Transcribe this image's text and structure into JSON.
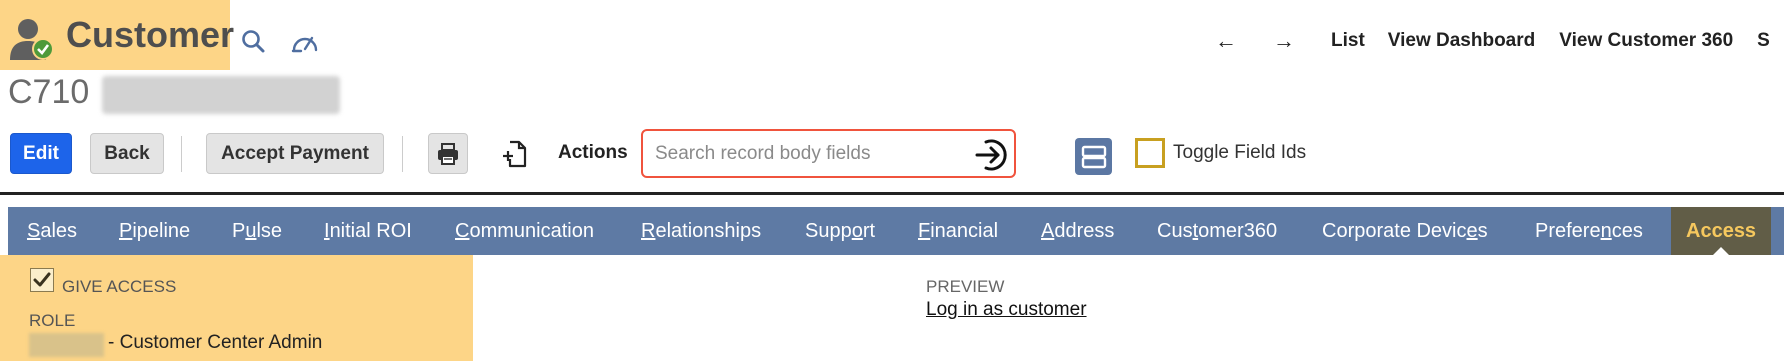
{
  "header": {
    "title": "Customer",
    "record_id": "C710",
    "record_icon": "customer-approved-icon",
    "search_icon": "search-icon",
    "dashboard_icon": "speedometer-icon"
  },
  "topnav": {
    "back_arrow": "←",
    "forward_arrow": "→",
    "list": "List",
    "view_dashboard": "View Dashboard",
    "view_customer_360": "View Customer 360",
    "overflow": "S"
  },
  "toolbar": {
    "edit": "Edit",
    "back": "Back",
    "accept_payment": "Accept Payment",
    "actions": "Actions",
    "search_placeholder": "Search record body fields",
    "toggle_field_ids": "Toggle Field Ids"
  },
  "tabs": [
    {
      "label": "Sales",
      "u": 0
    },
    {
      "label": "Pipeline",
      "u": 0
    },
    {
      "label": "Pulse",
      "u": 1
    },
    {
      "label": "Initial ROI",
      "u": 0
    },
    {
      "label": "Communication",
      "u": 0
    },
    {
      "label": "Relationships",
      "u": 0
    },
    {
      "label": "Support",
      "u": 4
    },
    {
      "label": "Financial",
      "u": 0
    },
    {
      "label": "Address",
      "u": 0
    },
    {
      "label": "Customer360",
      "u": 3
    },
    {
      "label": "Corporate Devices",
      "u": 15
    },
    {
      "label": "Preferences",
      "u": 7
    },
    {
      "label": "Access",
      "u": -1,
      "active": true
    }
  ],
  "access": {
    "give_access_label": "GIVE ACCESS",
    "give_access_checked": true,
    "role_label": "ROLE",
    "role_value": "- Customer Center Admin",
    "preview_label": "PREVIEW",
    "login_link": "Log in as customer"
  },
  "colors": {
    "title_highlight": "#fdd587",
    "primary_button": "#1d64ea",
    "tab_bar": "#5e7aa4",
    "active_tab_bg": "#615d47",
    "active_tab_text": "#f6c85e",
    "search_border": "#f0533d"
  }
}
